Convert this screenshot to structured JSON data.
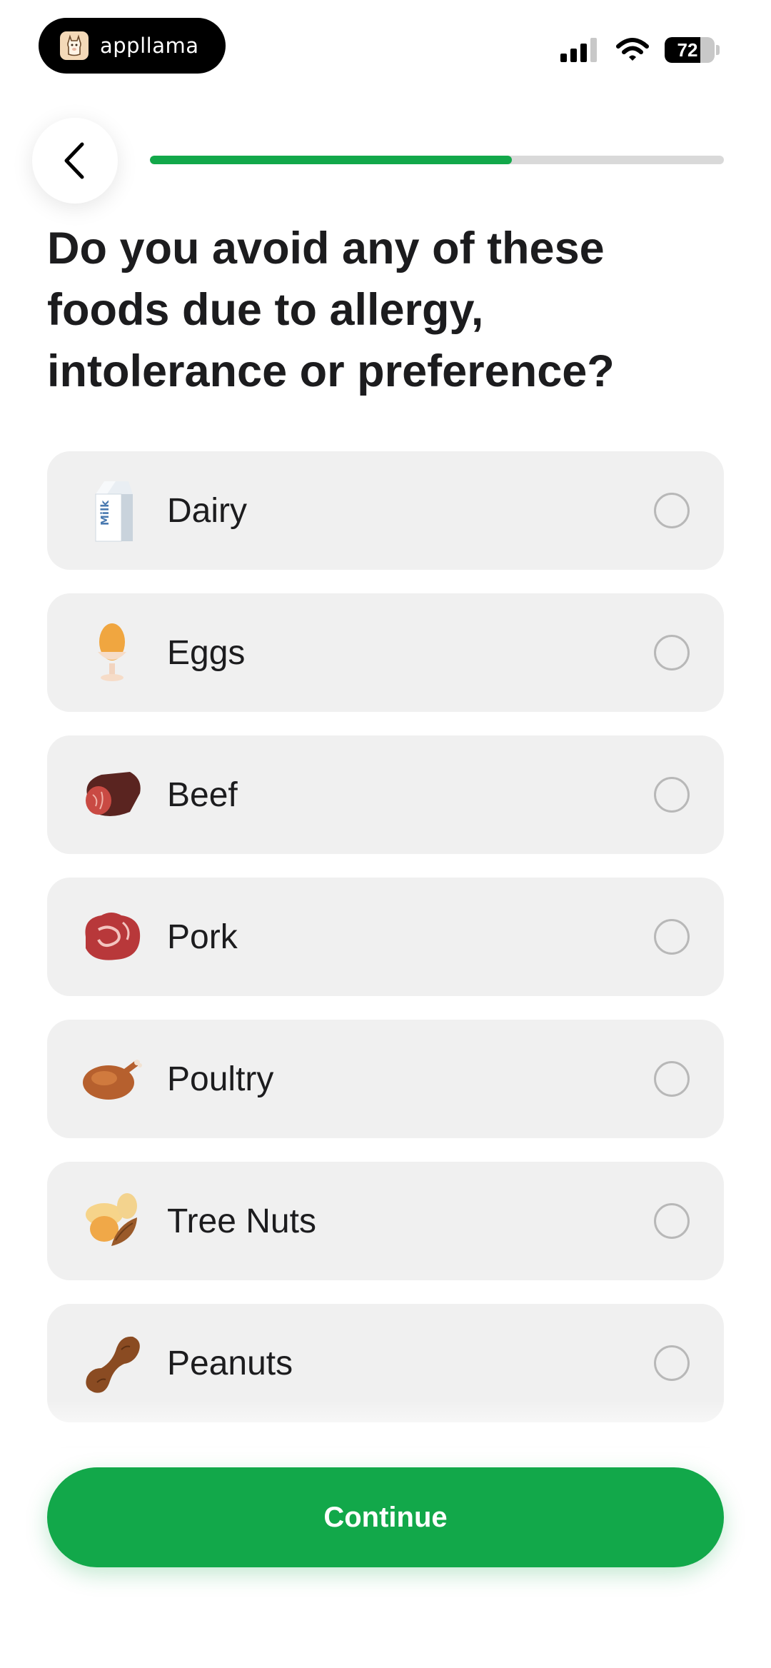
{
  "status_bar": {
    "app_name": "appllama",
    "battery_percent": 72,
    "battery_label": "72"
  },
  "header": {
    "progress_fraction": 0.63
  },
  "question": "Do you avoid any of these foods due to allergy, intolerance or preference?",
  "options": [
    {
      "label": "Dairy",
      "icon": "milk-carton-icon",
      "selected": false
    },
    {
      "label": "Eggs",
      "icon": "egg-cup-icon",
      "selected": false
    },
    {
      "label": "Beef",
      "icon": "beef-icon",
      "selected": false
    },
    {
      "label": "Pork",
      "icon": "pork-icon",
      "selected": false
    },
    {
      "label": "Poultry",
      "icon": "roast-chicken-icon",
      "selected": false
    },
    {
      "label": "Tree Nuts",
      "icon": "tree-nuts-icon",
      "selected": false
    },
    {
      "label": "Peanuts",
      "icon": "peanut-icon",
      "selected": false
    }
  ],
  "continue_label": "Continue",
  "colors": {
    "accent": "#12a84a",
    "option_bg": "#f0f0f0",
    "progress_track": "#d9d9d9"
  }
}
